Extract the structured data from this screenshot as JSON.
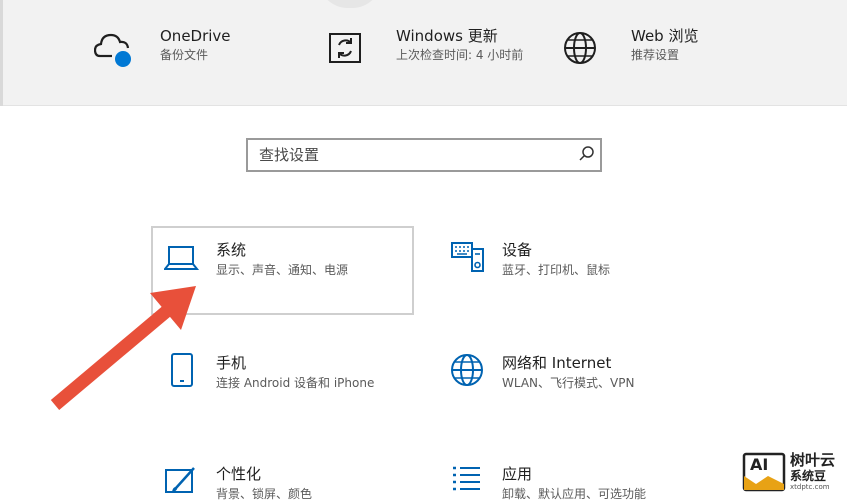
{
  "header": {
    "items": [
      {
        "title": "OneDrive",
        "subtitle": "备份文件",
        "icon": "cloud-icon"
      },
      {
        "title": "Windows 更新",
        "subtitle": "上次检查时间: 4 小时前",
        "icon": "sync-icon"
      },
      {
        "title": "Web 浏览",
        "subtitle": "推荐设置",
        "icon": "globe-icon"
      }
    ]
  },
  "search": {
    "placeholder": "查找设置",
    "icon": "search-icon"
  },
  "tiles": [
    {
      "title": "系统",
      "subtitle": "显示、声音、通知、电源",
      "icon": "laptop-icon"
    },
    {
      "title": "设备",
      "subtitle": "蓝牙、打印机、鼠标",
      "icon": "keyboard-icon"
    },
    {
      "title": "手机",
      "subtitle": "连接 Android 设备和 iPhone",
      "icon": "phone-icon"
    },
    {
      "title": "网络和 Internet",
      "subtitle": "WLAN、飞行模式、VPN",
      "icon": "globe-icon"
    },
    {
      "title": "个性化",
      "subtitle": "背景、锁屏、颜色",
      "icon": "brush-icon"
    },
    {
      "title": "应用",
      "subtitle": "卸载、默认应用、可选功能",
      "icon": "list-icon"
    }
  ],
  "watermark": {
    "logo_text": "AI",
    "main": "树叶云",
    "brand": "系统豆",
    "url": "xtdptc.com"
  },
  "colors": {
    "accent": "#0063b1",
    "arrow": "#e8503a",
    "header_bg": "#f2f2f2"
  }
}
